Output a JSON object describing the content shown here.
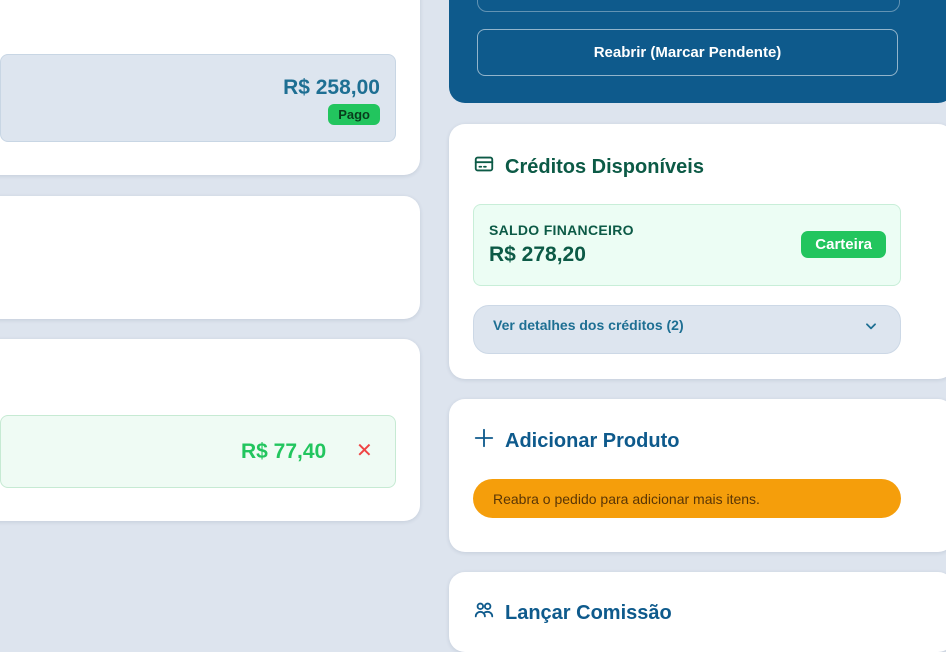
{
  "left_column": {
    "paid_item": {
      "amount": "R$ 258,00",
      "status": "Pago"
    },
    "credit_item": {
      "amount": "R$ 77,40"
    }
  },
  "status_panel": {
    "reopen_button": "Reabrir (Marcar Pendente)"
  },
  "credits": {
    "title": "Créditos Disponíveis",
    "balance_label": "SALDO FINANCEIRO",
    "balance_value": "R$ 278,20",
    "wallet_badge": "Carteira",
    "details_toggle": "Ver detalhes dos créditos (2)"
  },
  "add_product": {
    "title": "Adicionar Produto",
    "notice": "Reabra o pedido para adicionar mais itens."
  },
  "commission": {
    "title": "Lançar Comissão"
  },
  "colors": {
    "background": "#dde4ee",
    "panel_blue": "#0e5a8c",
    "success_green": "#22c55e",
    "warning_amber": "#f59e0b",
    "danger_red": "#ef4444"
  },
  "icons": [
    "credit-card-icon",
    "plus-icon",
    "users-icon",
    "chevron-down-icon",
    "close-icon"
  ]
}
